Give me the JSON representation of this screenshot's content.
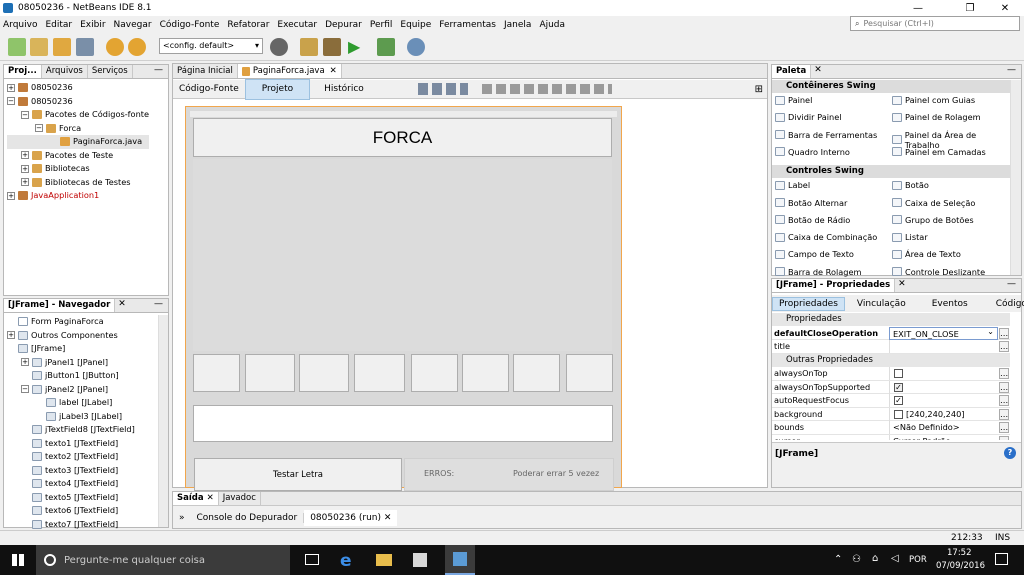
{
  "window": {
    "title": "08050236 - NetBeans IDE 8.1",
    "min": "—",
    "max": "❐",
    "close": "✕"
  },
  "menu": [
    "Arquivo",
    "Editar",
    "Exibir",
    "Navegar",
    "Código-Fonte",
    "Refatorar",
    "Executar",
    "Depurar",
    "Perfil",
    "Equipe",
    "Ferramentas",
    "Janela",
    "Ajuda"
  ],
  "search": {
    "placeholder": "Pesquisar (Ctrl+I)"
  },
  "toolbar": {
    "config": "<config. default>"
  },
  "projects": {
    "tabs": [
      "Proj...",
      "Arquivos",
      "Serviços"
    ],
    "items": [
      {
        "label": "08050236",
        "indent": 0,
        "color": "#000"
      },
      {
        "label": "08050236",
        "indent": 0,
        "color": "#000"
      },
      {
        "label": "Pacotes de Códigos-fonte",
        "indent": 1,
        "color": "#000"
      },
      {
        "label": "Forca",
        "indent": 2,
        "color": "#000"
      },
      {
        "label": "PaginaForca.java",
        "indent": 3,
        "color": "#000"
      },
      {
        "label": "Pacotes de Teste",
        "indent": 1,
        "color": "#000"
      },
      {
        "label": "Bibliotecas",
        "indent": 1,
        "color": "#000"
      },
      {
        "label": "Bibliotecas de Testes",
        "indent": 1,
        "color": "#000"
      },
      {
        "label": "JavaApplication1",
        "indent": 0,
        "color": "#c00000"
      }
    ]
  },
  "navigator": {
    "title": "[JFrame] - Navegador",
    "items": [
      {
        "label": "Form PaginaForca",
        "indent": 0
      },
      {
        "label": "Outros Componentes",
        "indent": 0
      },
      {
        "label": "[JFrame]",
        "indent": 0
      },
      {
        "label": "jPanel1 [JPanel]",
        "indent": 1
      },
      {
        "label": "jButton1 [JButton]",
        "indent": 1
      },
      {
        "label": "jPanel2 [JPanel]",
        "indent": 1
      },
      {
        "label": "label [JLabel]",
        "indent": 2
      },
      {
        "label": "jLabel3 [JLabel]",
        "indent": 2
      },
      {
        "label": "jTextField8 [JTextField]",
        "indent": 1
      },
      {
        "label": "texto1 [JTextField]",
        "indent": 1
      },
      {
        "label": "texto2 [JTextField]",
        "indent": 1
      },
      {
        "label": "texto3 [JTextField]",
        "indent": 1
      },
      {
        "label": "texto4 [JTextField]",
        "indent": 1
      },
      {
        "label": "texto5 [JTextField]",
        "indent": 1
      },
      {
        "label": "texto6 [JTextField]",
        "indent": 1
      },
      {
        "label": "texto7 [JTextField]",
        "indent": 1
      }
    ]
  },
  "editor": {
    "tabs": [
      "Página Inicial",
      "PaginaForca.java"
    ],
    "subtabs": [
      "Código-Fonte",
      "Projeto",
      "Histórico"
    ],
    "form_title": "FORCA",
    "button": "Testar Letra",
    "erros": "ERROS:",
    "hint": "Poderar errar 5 vezez"
  },
  "palette": {
    "title": "Paleta",
    "sections": [
      {
        "name": "Contêineres Swing",
        "items": [
          "Painel",
          "Painel com Guias",
          "Dividir Painel",
          "Painel de Rolagem",
          "Barra de Ferramentas",
          "Painel da Área de Trabalho",
          "Quadro Interno",
          "Painel em Camadas"
        ]
      },
      {
        "name": "Controles Swing",
        "items": [
          "Label",
          "Botão",
          "Botão Alternar",
          "Caixa de Seleção",
          "Botão de Rádio",
          "Grupo de Botões",
          "Caixa de Combinação",
          "Listar",
          "Campo de Texto",
          "Área de Texto",
          "Barra de Rolagem",
          "Controle Deslizante"
        ]
      }
    ]
  },
  "props": {
    "title": "[JFrame] - Propriedades",
    "tabs": [
      "Propriedades",
      "Vinculação",
      "Eventos",
      "Código"
    ],
    "sec1": "Propriedades",
    "sec2": "Outras Propriedades",
    "rows": [
      {
        "name": "defaultCloseOperation",
        "value": "EXIT_ON_CLOSE",
        "bold": true
      },
      {
        "name": "title",
        "value": "",
        "bold": false
      }
    ],
    "rows2": [
      {
        "name": "alwaysOnTop",
        "value": "",
        "bold": false
      },
      {
        "name": "alwaysOnTopSupported",
        "value": "",
        "bold": false
      },
      {
        "name": "autoRequestFocus",
        "value": "",
        "bold": false
      },
      {
        "name": "background",
        "value": "[240,240,240]",
        "bold": false
      },
      {
        "name": "bounds",
        "value": "<Não Definido>",
        "bold": false
      },
      {
        "name": "cursor",
        "value": "Cursor Padrão",
        "bold": false
      }
    ],
    "footer": "[JFrame]"
  },
  "output": {
    "tabs": [
      "Saída",
      "Javadoc"
    ],
    "subtabs": [
      "Console do Depurador",
      "08050236 (run)"
    ]
  },
  "status": {
    "pos": "212:33",
    "ins": "INS"
  },
  "taskbar": {
    "search": "Pergunte-me qualquer coisa",
    "lang": "POR",
    "time": "17:52",
    "date": "07/09/2016"
  }
}
